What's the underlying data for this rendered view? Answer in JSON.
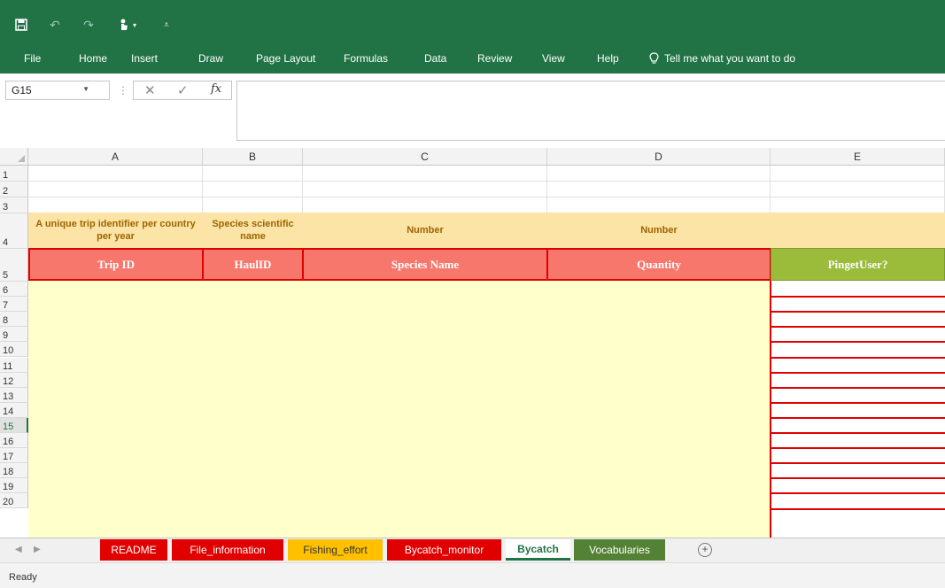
{
  "menu": {
    "items": [
      "File",
      "Home",
      "Insert",
      "Draw",
      "Page Layout",
      "Formulas",
      "Data",
      "Review",
      "View",
      "Help"
    ],
    "tell_me": "Tell me what you want to do"
  },
  "formula_bar": {
    "name_box": "G15",
    "fx_label": "fx",
    "content": ""
  },
  "columns": [
    "A",
    "B",
    "C",
    "D",
    "E"
  ],
  "rows": [
    "1",
    "2",
    "3",
    "4",
    "5",
    "6",
    "7",
    "8",
    "9",
    "10",
    "11",
    "12",
    "13",
    "14",
    "15",
    "16",
    "17",
    "18",
    "19",
    "20"
  ],
  "selected_row": "15",
  "row4": {
    "a": "A unique trip identifier per country per year",
    "b": "Species scientific name",
    "c": "Number",
    "d": "Number"
  },
  "row5": {
    "a": "Trip ID",
    "b": "HaulID",
    "c": "Species Name",
    "d": "Quantity",
    "e": "PingetUser?"
  },
  "sheet_tabs": [
    {
      "label": "README",
      "style": "red"
    },
    {
      "label": "File_information",
      "style": "red"
    },
    {
      "label": "Fishing_effort",
      "style": "orange"
    },
    {
      "label": "Bycatch_monitor",
      "style": "red"
    },
    {
      "label": "Bycatch",
      "style": "active"
    },
    {
      "label": "Vocabularies",
      "style": "green"
    }
  ],
  "add_sheet_label": "+",
  "status_text": "Ready",
  "colors": {
    "ribbon": "#217346",
    "desc_fill": "#fce4a6",
    "header_red": "#f8776d",
    "header_green": "#9bbb3b",
    "body_yellow": "#ffffcc",
    "border_red": "#e00000"
  }
}
